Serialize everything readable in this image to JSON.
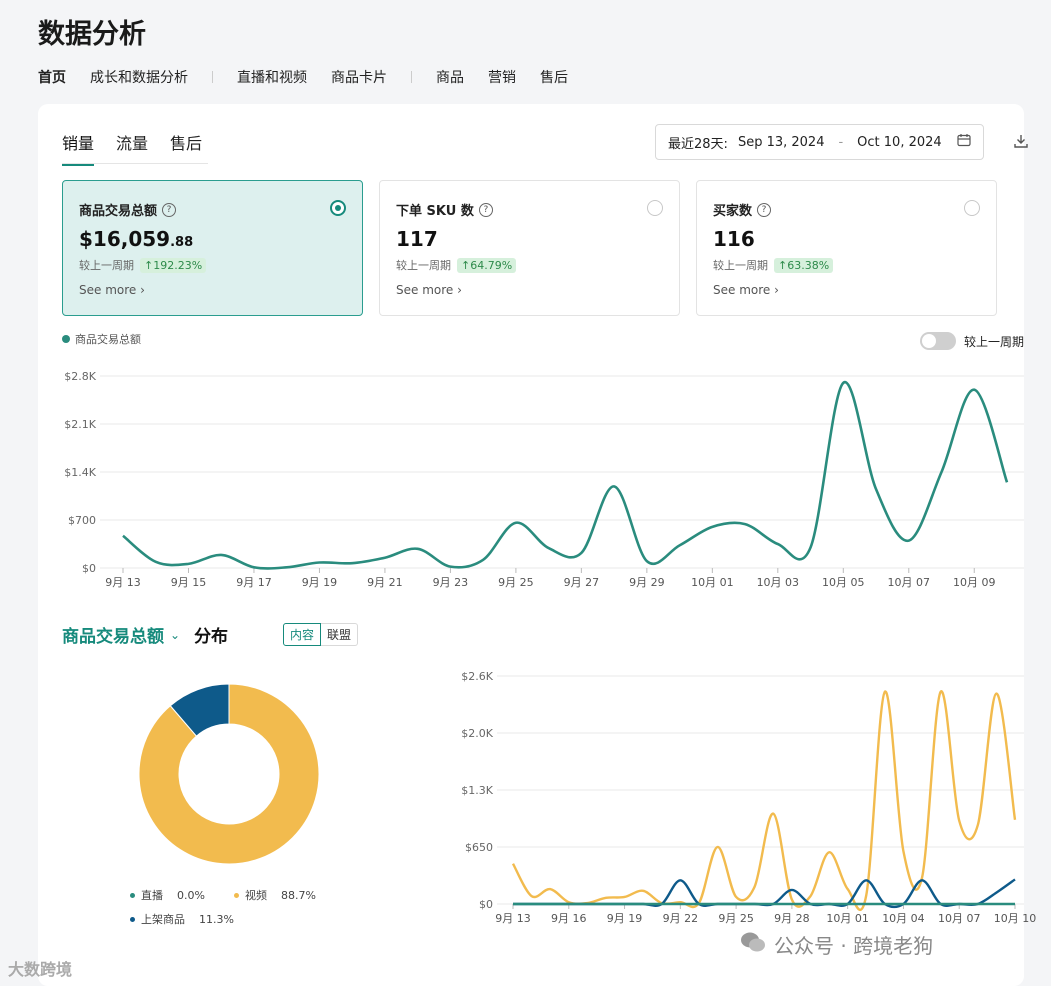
{
  "page_title": "数据分析",
  "top_nav": [
    {
      "label": "首页",
      "active": true
    },
    {
      "label": "成长和数据分析"
    },
    {
      "sep": true
    },
    {
      "label": "直播和视频"
    },
    {
      "label": "商品卡片"
    },
    {
      "sep": true
    },
    {
      "label": "商品"
    },
    {
      "label": "营销"
    },
    {
      "label": "售后"
    }
  ],
  "sub_tabs": [
    "销量",
    "流量",
    "售后"
  ],
  "date_range": {
    "prefix": "最近28天:",
    "start": "Sep 13, 2024",
    "separator": "-",
    "end": "Oct 10, 2024",
    "calendar_icon": "calendar-icon",
    "download_icon": "download-icon"
  },
  "metrics": [
    {
      "title": "商品交易总额",
      "value_main": "$16,059",
      "value_dec": ".88",
      "compare_label": "较上一周期",
      "change": "192.23%",
      "more": "See more",
      "selected": true
    },
    {
      "title": "下单 SKU 数",
      "value_main": "117",
      "value_dec": "",
      "compare_label": "较上一周期",
      "change": "64.79%",
      "more": "See more",
      "selected": false
    },
    {
      "title": "买家数",
      "value_main": "116",
      "value_dec": "",
      "compare_label": "较上一周期",
      "change": "63.38%",
      "more": "See more",
      "selected": false
    }
  ],
  "main_legend": "商品交易总额",
  "compare_toggle_label": "较上一周期",
  "colors": {
    "accent": "#168a7c",
    "line": "#2a8c7e",
    "video": "#f2bb4e",
    "listing": "#0e5a8a",
    "badge_bg": "#d6f0dc",
    "badge_text": "#2d8a4a"
  },
  "distribution": {
    "selector": "商品交易总额",
    "title": "分布",
    "segments": [
      "内容",
      "联盟"
    ],
    "legend": [
      {
        "name": "直播",
        "pct": "0.0%",
        "color": "#2a8c7e"
      },
      {
        "name": "视频",
        "pct": "88.7%",
        "color": "#f2bb4e"
      },
      {
        "name": "上架商品",
        "pct": "11.3%",
        "color": "#0e5a8a"
      }
    ]
  },
  "watermark": {
    "wechat": "公众号 · 跨境老狗",
    "logo": "大数跨境"
  },
  "chart_data": [
    {
      "type": "line",
      "title": "商品交易总额",
      "x": [
        "9月 13",
        "9月 14",
        "9月 15",
        "9月 16",
        "9月 17",
        "9月 18",
        "9月 19",
        "9月 20",
        "9月 21",
        "9月 22",
        "9月 23",
        "9月 24",
        "9月 25",
        "9月 26",
        "9月 27",
        "9月 28",
        "9月 29",
        "9月 30",
        "10月 01",
        "10月 02",
        "10月 03",
        "10月 04",
        "10月 05",
        "10月 06",
        "10月 07",
        "10月 08",
        "10月 09",
        "10月 10"
      ],
      "x_tick_labels": [
        "9月 13",
        "9月 15",
        "9月 17",
        "9月 19",
        "9月 21",
        "9月 23",
        "9月 25",
        "9月 27",
        "9月 29",
        "10月 01",
        "10月 03",
        "10月 05",
        "10月 07",
        "10月 09"
      ],
      "series": [
        {
          "name": "商品交易总额",
          "values": [
            470,
            90,
            60,
            190,
            10,
            10,
            80,
            70,
            150,
            280,
            20,
            120,
            660,
            290,
            220,
            1190,
            100,
            330,
            600,
            640,
            350,
            300,
            2700,
            1150,
            400,
            1400,
            2600,
            1250
          ]
        }
      ],
      "y_ticks": [
        "$0",
        "$700",
        "$1.4K",
        "$2.1K",
        "$2.8K"
      ],
      "ylim": [
        0,
        2800
      ]
    },
    {
      "type": "line",
      "x": [
        "9月 13",
        "9月 14",
        "9月 15",
        "9月 16",
        "9月 17",
        "9月 18",
        "9月 19",
        "9月 20",
        "9月 21",
        "9月 22",
        "9月 23",
        "9月 24",
        "9月 25",
        "9月 26",
        "9月 27",
        "9月 28",
        "9月 29",
        "9月 30",
        "10月 01",
        "10月 02",
        "10月 03",
        "10月 04",
        "10月 05",
        "10月 06",
        "10月 07",
        "10月 08",
        "10月 09",
        "10月 10"
      ],
      "x_tick_labels": [
        "9月 13",
        "9月 16",
        "9月 19",
        "9月 22",
        "9月 25",
        "9月 28",
        "10月 01",
        "10月 04",
        "10月 07",
        "10月 10"
      ],
      "series": [
        {
          "name": "视频",
          "values": [
            460,
            90,
            170,
            20,
            10,
            70,
            80,
            150,
            10,
            20,
            10,
            650,
            80,
            200,
            1030,
            50,
            90,
            590,
            170,
            100,
            2420,
            600,
            300,
            2420,
            950,
            900,
            2400,
            960
          ]
        },
        {
          "name": "上架商品",
          "values": [
            0,
            0,
            0,
            0,
            0,
            0,
            0,
            0,
            0,
            270,
            0,
            0,
            0,
            0,
            0,
            160,
            0,
            0,
            0,
            270,
            0,
            0,
            270,
            0,
            0,
            0,
            130,
            280
          ]
        },
        {
          "name": "直播",
          "values": [
            0,
            0,
            0,
            0,
            0,
            0,
            0,
            0,
            0,
            0,
            0,
            0,
            0,
            0,
            0,
            0,
            0,
            0,
            0,
            0,
            0,
            0,
            0,
            0,
            0,
            0,
            0,
            0
          ]
        }
      ],
      "y_ticks": [
        "$0",
        "$650",
        "$1.3K",
        "$2.0K",
        "$2.6K"
      ],
      "ylim": [
        0,
        2600
      ]
    },
    {
      "type": "pie",
      "categories": [
        "直播",
        "视频",
        "上架商品"
      ],
      "values": [
        0.0,
        88.7,
        11.3
      ]
    }
  ]
}
